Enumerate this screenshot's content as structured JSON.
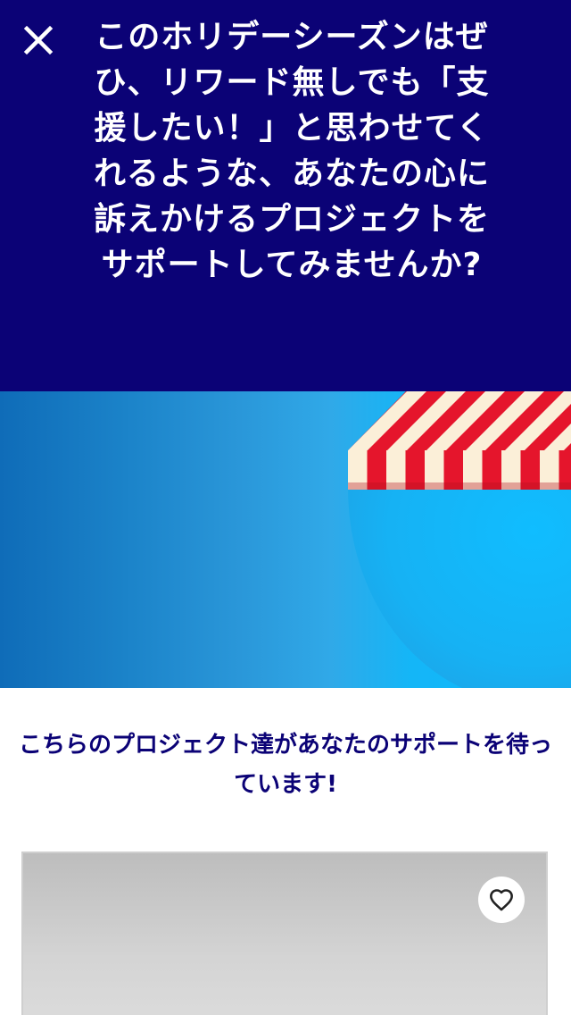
{
  "header": {
    "close_icon": "close-icon",
    "headline": "このホリデーシーズンはぜひ、リワード無しでも「支援したい！」と思わせてくれるような、あなたの心に訴えかけるプロジェクトをサポートしてみませんか?"
  },
  "hero": {
    "illustration": "striped-awning",
    "colors": {
      "background": "#1a8fd2",
      "stripe_red": "#e5152c",
      "stripe_cream": "#fbefd8"
    }
  },
  "section": {
    "subtitle": "こちらのプロジェクト達があなたのサポートを待っています!"
  },
  "card": {
    "favorite_icon": "heart-outline-icon"
  },
  "colors": {
    "header_bg": "#0b0276",
    "accent_text": "#0b0276",
    "header_text": "#ffffff"
  }
}
